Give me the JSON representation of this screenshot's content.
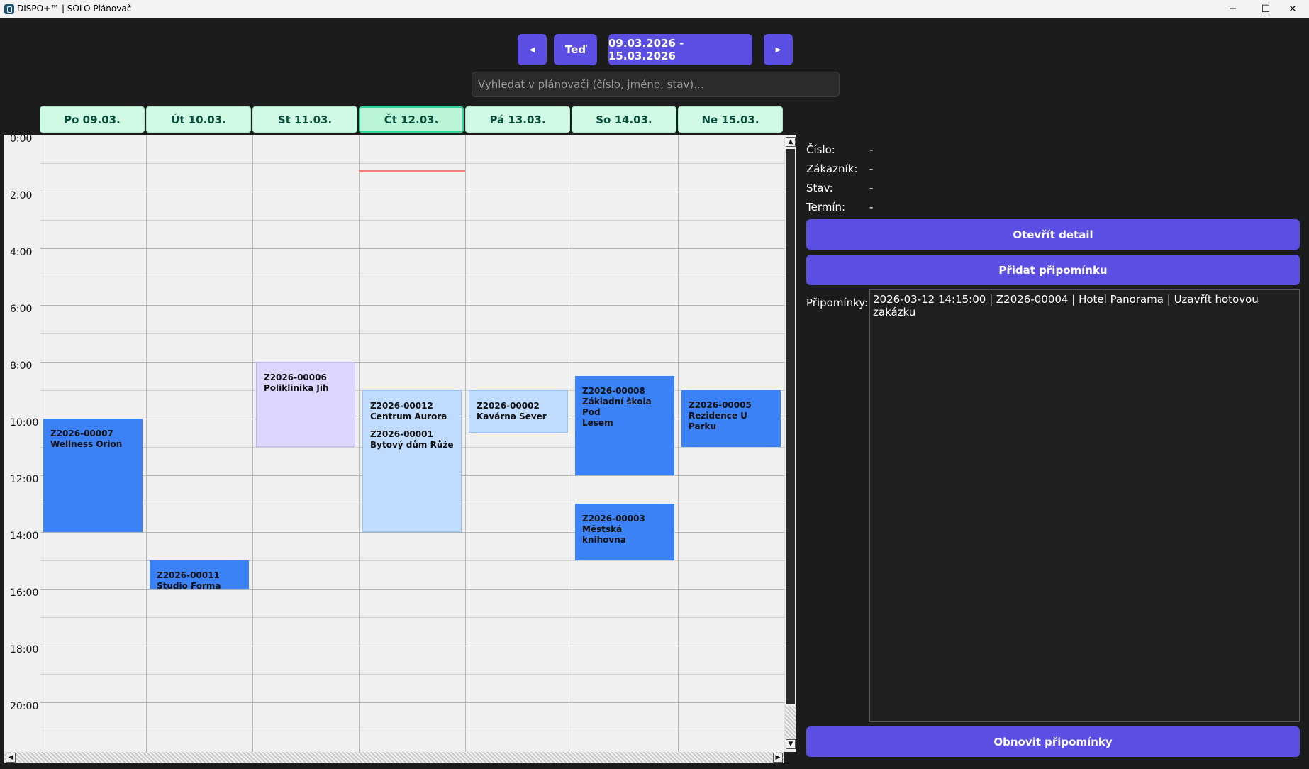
{
  "window": {
    "title": "DISPO+™ | SOLO Plánovač",
    "minimize": "─",
    "maximize": "☐",
    "close": "✕"
  },
  "toolbar": {
    "prev": "◀",
    "today": "Teď",
    "range": "09.03.2026 - 15.03.2026",
    "next": "▶",
    "search_placeholder": "Vyhledat v plánovači (číslo, jméno, stav)..."
  },
  "days": [
    "Po 09.03.",
    "Út 10.03.",
    "St 11.03.",
    "Čt 12.03.",
    "Pá 13.03.",
    "So 14.03.",
    "Ne 15.03."
  ],
  "hours": [
    "0:00",
    "2:00",
    "4:00",
    "6:00",
    "8:00",
    "10:00",
    "12:00",
    "14:00",
    "16:00",
    "18:00",
    "20:00"
  ],
  "events": [
    {
      "lines": [
        "Z2026-00007",
        "Wellness Orion"
      ]
    },
    {
      "lines": [
        "Z2026-00011",
        "Studio Forma"
      ]
    },
    {
      "lines": [
        "Z2026-00006",
        "Poliklinika Jih"
      ]
    },
    {
      "lines": [
        "Z2026-00012",
        "Centrum Aurora"
      ],
      "lines2": [
        "Z2026-00001",
        "Bytový dům Růže"
      ]
    },
    {
      "lines": [
        "Z2026-00002",
        "Kavárna Sever"
      ]
    },
    {
      "lines": [
        "Z2026-00008",
        "Základní škola Pod",
        "Lesem"
      ]
    },
    {
      "lines": [
        "Z2026-00003",
        "Městská knihovna"
      ]
    },
    {
      "lines": [
        "Z2026-00005",
        "Rezidence U Parku"
      ]
    }
  ],
  "details": {
    "cislo_label": "Číslo:",
    "cislo_value": "-",
    "zakaznik_label": "Zákazník:",
    "zakaznik_value": "-",
    "stav_label": "Stav:",
    "stav_value": "-",
    "termin_label": "Termín:",
    "termin_value": "-"
  },
  "actions": {
    "open_detail": "Otevřít detail",
    "add_reminder": "Přidat připomínku",
    "refresh_reminders": "Obnovit připomínky"
  },
  "reminders": {
    "label": "Připomínky:",
    "items": [
      "2026-03-12 14:15:00 | Z2026-00004 | Hotel Panorama | Uzavřít hotovou zakázku"
    ]
  },
  "colors": {
    "accent": "#5b4ee2",
    "event_blue": "#3b82f6",
    "event_light": "#bfdbfe",
    "event_violet": "#ddd6fe",
    "day_header": "#d1fae5",
    "now_line": "#f08080"
  }
}
